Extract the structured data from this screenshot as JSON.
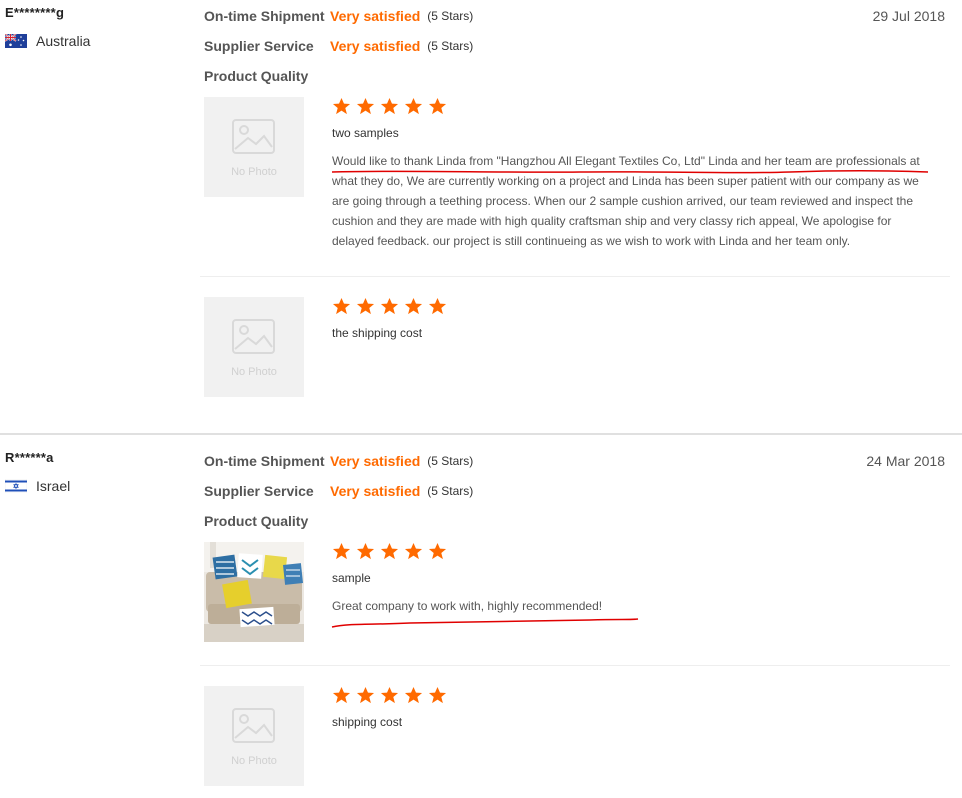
{
  "rating_labels": {
    "shipment": "On-time Shipment",
    "service": "Supplier Service",
    "quality": "Product Quality"
  },
  "reviews": [
    {
      "buyer": "E********g",
      "country": "Australia",
      "flag_icon": "australia-flag-icon",
      "date": "29 Jul 2018",
      "shipment_value": "Very satisfied",
      "shipment_stars": "(5 Stars)",
      "service_value": "Very satisfied",
      "service_stars": "(5 Stars)",
      "items": [
        {
          "product": "two samples",
          "text": "Would like to thank Linda from \"Hangzhou All Elegant Textiles Co, Ltd\" Linda and her team are professionals at what they do, We are currently working on a project and Linda has been super patient with our company as we are going through a teething process. When our 2 sample cushion arrived, our team reviewed and inspect the cushion and they are made with high quality craftsman ship and very classy rich appeal, We apologise for delayed feedback. our project is still continueing as we wish to work with Linda and her team only.",
          "photo_text": "No Photo",
          "rating": 5
        },
        {
          "product": "the shipping cost",
          "photo_text": "No Photo",
          "rating": 5
        }
      ]
    },
    {
      "buyer": "R******a",
      "country": "Israel",
      "flag_icon": "israel-flag-icon",
      "date": "24 Mar 2018",
      "shipment_value": "Very satisfied",
      "shipment_stars": "(5 Stars)",
      "service_value": "Very satisfied",
      "service_stars": "(5 Stars)",
      "items": [
        {
          "product": "sample",
          "text": "Great company to work with, highly recommended!",
          "rating": 5
        },
        {
          "product": "shipping cost",
          "photo_text": "No Photo",
          "rating": 5
        }
      ]
    }
  ],
  "colors": {
    "accent": "#ff6a00",
    "annotation": "#e00000"
  }
}
